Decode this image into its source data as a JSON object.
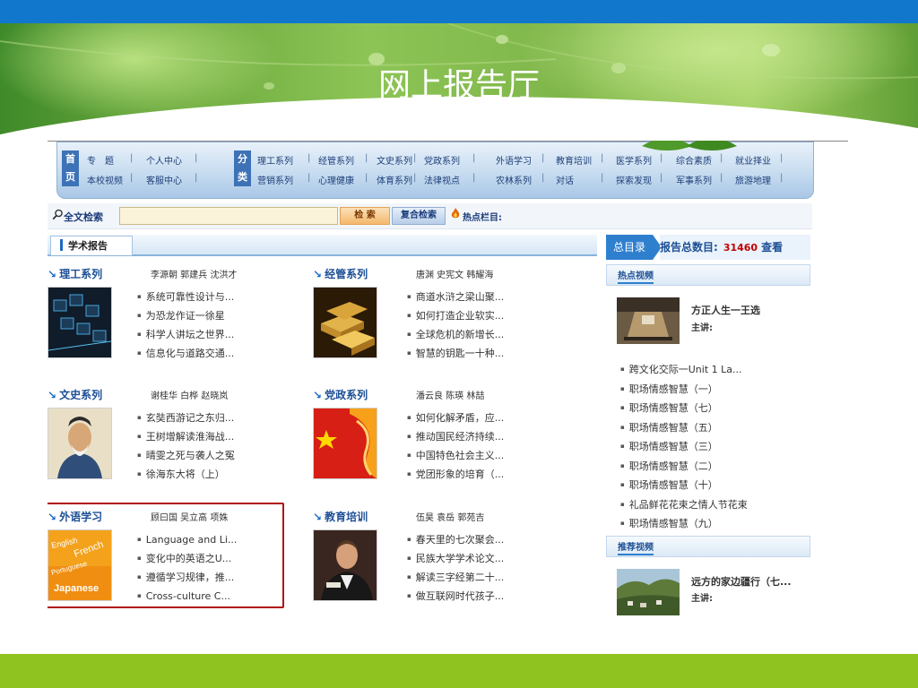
{
  "slide_title": "网上报告厅",
  "nav": {
    "home_block": "首页",
    "category_block": "分类",
    "row1": [
      "专　题",
      "个人中心",
      "理工系列",
      "经管系列",
      "文史系列",
      "党政系列",
      "外语学习",
      "教育培训",
      "医学系列",
      "综合素质",
      "就业择业"
    ],
    "row2": [
      "本校视频",
      "客服中心",
      "营销系列",
      "心理健康",
      "体育系列",
      "法律视点",
      "农林系列",
      "对话",
      "探索发现",
      "军事系列",
      "旅游地理"
    ]
  },
  "search": {
    "label": "全文检索",
    "placeholder": "",
    "button": "检 索",
    "advanced_button": "复合检索",
    "hot_label": "热点栏目:"
  },
  "report_tab": "学术报告",
  "categories": [
    {
      "title": "理工系列",
      "teachers": "李源朝 郭建兵 沈洪才",
      "items": [
        "系统可靠性设计与...",
        "为恐龙作证一徐星",
        "科学人讲坛之世界...",
        "信息化与道路交通..."
      ]
    },
    {
      "title": "经管系列",
      "teachers": "唐渊 史宪文 韩耀海",
      "items": [
        "商道水浒之梁山聚...",
        "如何打造企业软实...",
        "全球危机的新增长...",
        "智慧的钥匙一十种..."
      ]
    },
    {
      "title": "文史系列",
      "teachers": "谢桂华 白桦 赵晓岚",
      "items": [
        "玄奘西游记之东归...",
        "王树增解读淮海战...",
        "晴雯之死与袭人之冤",
        "徐海东大将（上）"
      ]
    },
    {
      "title": "党政系列",
      "teachers": "潘云良 陈瑛 林喆",
      "items": [
        "如何化解矛盾，应...",
        "推动国民经济持续...",
        "中国特色社会主义...",
        "党团形象的培育（..."
      ]
    },
    {
      "title": "外语学习",
      "teachers": "顾曰国 吴立高 项姝",
      "items": [
        "Language and Li...",
        "变化中的英语之U...",
        "遵循学习规律，推...",
        "Cross-culture C..."
      ]
    },
    {
      "title": "教育培训",
      "teachers": "伍昊 袁岳 郭苑吉",
      "items": [
        "春天里的七次聚会...",
        "民族大学学术论文...",
        "解读三字经第二十...",
        "做互联网时代孩子..."
      ]
    }
  ],
  "thumb_words": [
    "English",
    "French",
    "Portuguese",
    "Japanese"
  ],
  "right": {
    "directory_label": "总目录",
    "total_label": "报告总数目:",
    "total_count": "31460",
    "view_label": "查看",
    "hot_video_header": "热点视频",
    "hot_video": {
      "title": "方正人生一王选",
      "speaker": "主讲:"
    },
    "hot_list": [
      "跨文化交际一Unit 1 La...",
      "职场情感智慧（一）",
      "职场情感智慧（七）",
      "职场情感智慧（五）",
      "职场情感智慧（三）",
      "职场情感智慧（二）",
      "职场情感智慧（十）",
      "礼品鲜花花束之情人节花束",
      "职场情感智慧（九）"
    ],
    "recommended_header": "推荐视频",
    "recommended_video": {
      "title": "远方的家边疆行（七...",
      "speaker": "主讲:"
    }
  },
  "colors": {
    "top_bar": "#1177cc",
    "bottom_bar": "#8fc31f",
    "highlight_border": "#b01010",
    "nav_text": "#1d3f78",
    "total_count": "#c00000"
  }
}
